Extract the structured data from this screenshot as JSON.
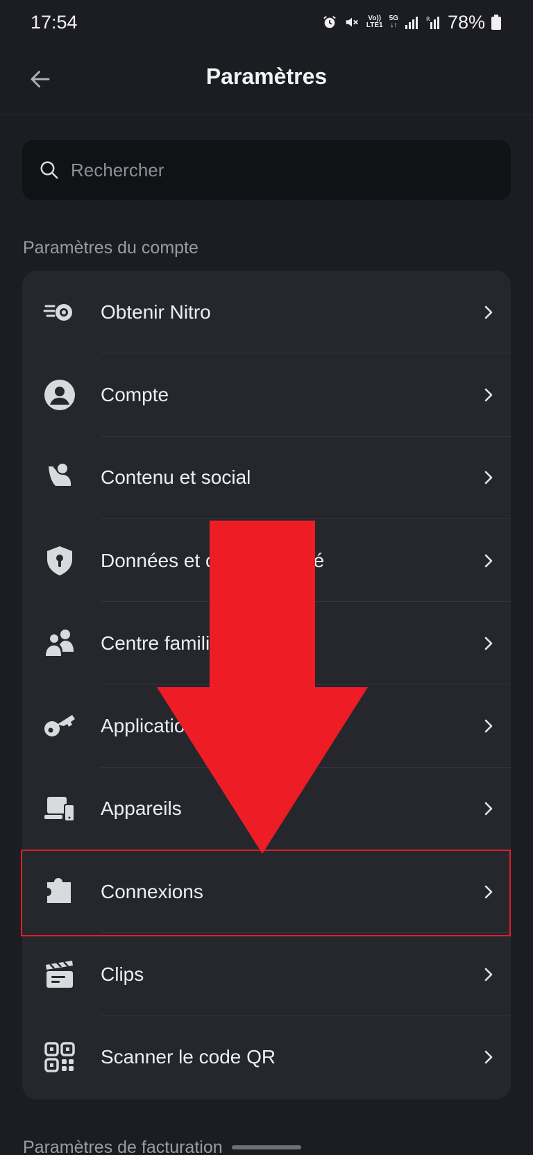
{
  "status_bar": {
    "time": "17:54",
    "volte_top": "Vo))",
    "volte_bottom": "LTE1",
    "network": "5G",
    "battery": "78%"
  },
  "header": {
    "title": "Paramètres",
    "back_icon": "arrow-left-icon"
  },
  "search": {
    "placeholder": "Rechercher",
    "icon": "search-icon"
  },
  "sections": {
    "account_title": "Paramètres du compte",
    "billing_title": "Paramètres de facturation"
  },
  "items": [
    {
      "label": "Obtenir Nitro",
      "icon": "nitro-icon"
    },
    {
      "label": "Compte",
      "icon": "user-circle-icon"
    },
    {
      "label": "Contenu et social",
      "icon": "person-content-icon"
    },
    {
      "label": "Données et confidentialité",
      "icon": "shield-keyhole-icon"
    },
    {
      "label": "Centre familial",
      "icon": "family-icon"
    },
    {
      "label": "Applications autorisées",
      "icon": "key-icon"
    },
    {
      "label": "Appareils",
      "icon": "devices-icon"
    },
    {
      "label": "Connexions",
      "icon": "puzzle-icon",
      "highlighted": true
    },
    {
      "label": "Clips",
      "icon": "clapperboard-icon"
    },
    {
      "label": "Scanner le code QR",
      "icon": "qr-code-icon"
    }
  ],
  "colors": {
    "background": "#1c1d22",
    "card": "#26272d",
    "annotation_red": "#e01e2a"
  }
}
